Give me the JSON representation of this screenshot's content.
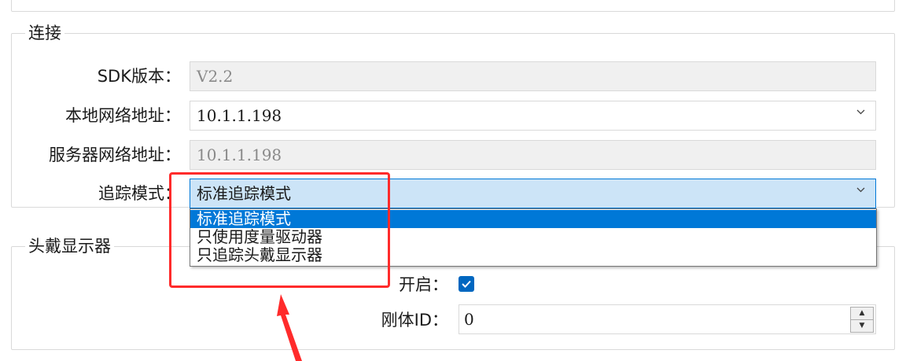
{
  "sections": {
    "connection_title": "连接",
    "hmd_title": "头戴显示器"
  },
  "connection": {
    "sdk_label": "SDK版本：",
    "sdk_value": "V2.2",
    "local_label": "本地网络地址：",
    "local_value": "10.1.1.198",
    "server_label": "服务器网络地址：",
    "server_value": "10.1.1.198",
    "mode_label": "追踪模式：",
    "mode_value": "标准追踪模式",
    "mode_options": [
      "标准追踪模式",
      "只使用度量驱动器",
      "只追踪头戴显示器"
    ]
  },
  "hmd": {
    "enable_label": "开启：",
    "enable_checked": true,
    "rigid_label": "刚体ID：",
    "rigid_value": "0"
  },
  "colors": {
    "accent": "#0078d7",
    "annotation": "#ff2b2b"
  },
  "icons": [
    "chevron-down-icon",
    "check-icon",
    "spin-up-icon",
    "spin-down-icon",
    "annotation-arrow-icon"
  ]
}
